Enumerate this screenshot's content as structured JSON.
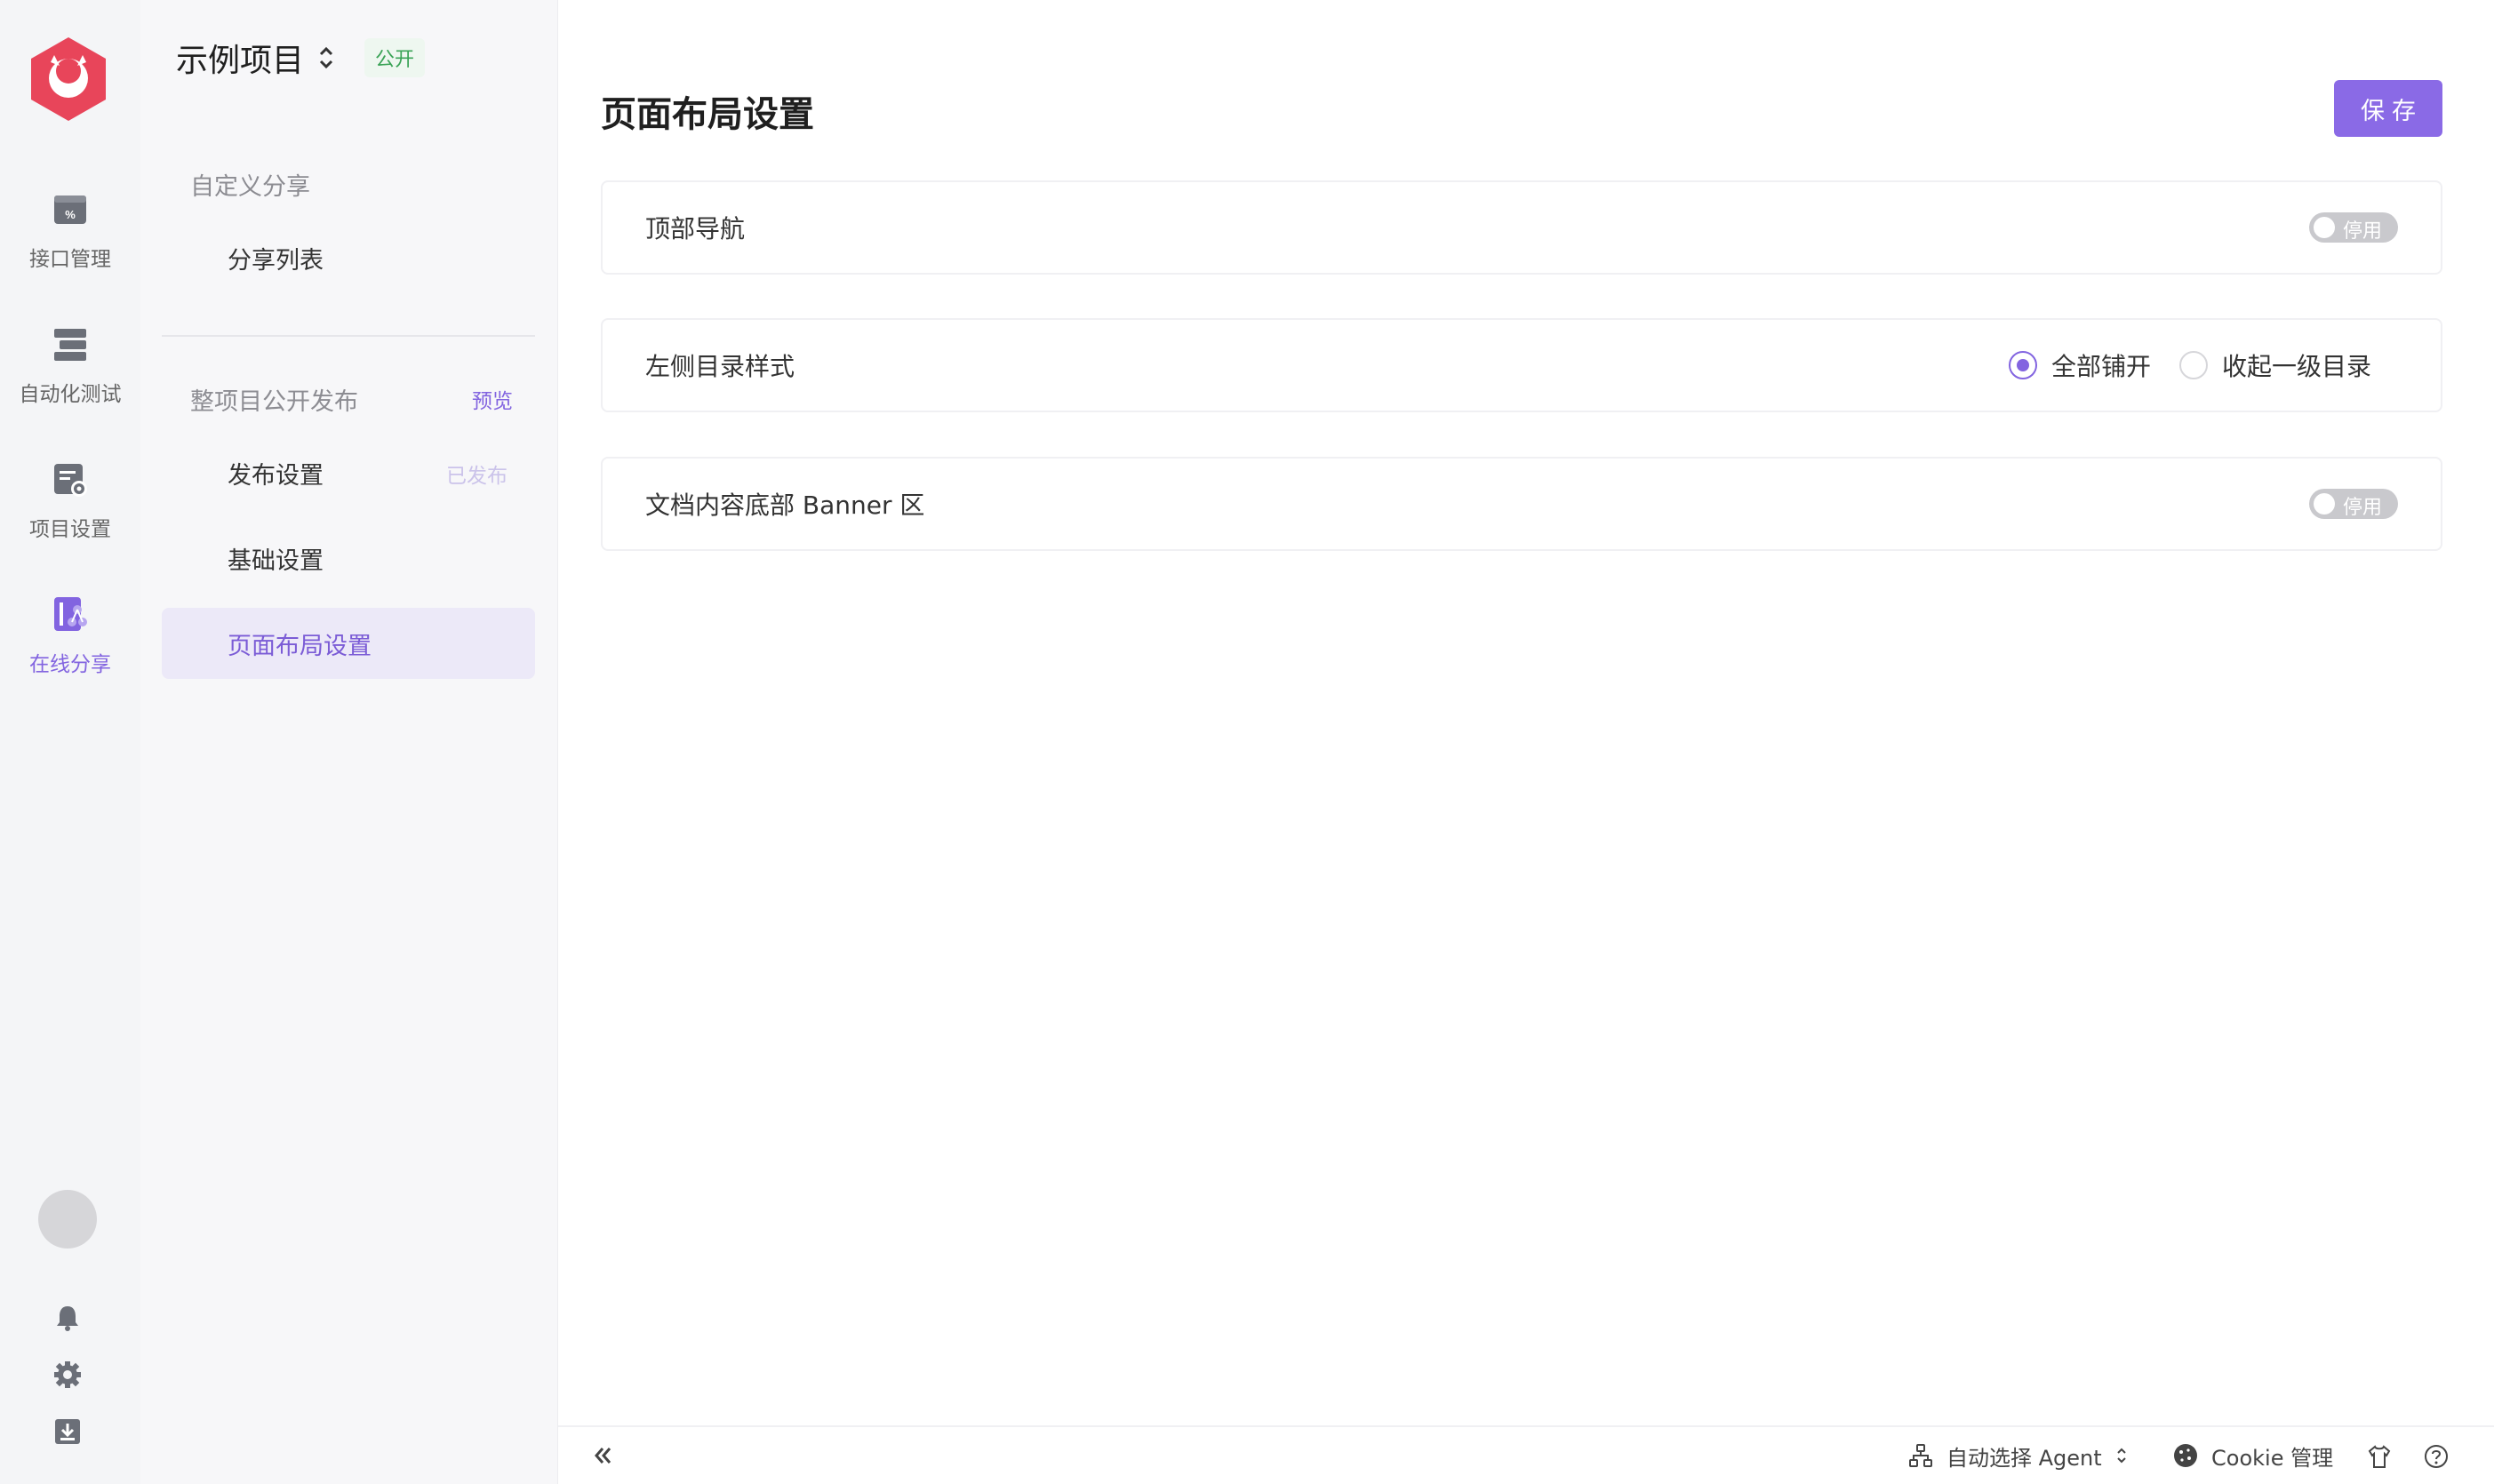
{
  "project": {
    "name": "示例项目",
    "badge": "公开"
  },
  "rail": {
    "items": [
      {
        "label": "接口管理",
        "icon": "api-icon"
      },
      {
        "label": "自动化测试",
        "icon": "automation-icon"
      },
      {
        "label": "项目设置",
        "icon": "project-settings-icon"
      },
      {
        "label": "在线分享",
        "icon": "share-icon"
      }
    ],
    "active_index": 3
  },
  "sidebar": {
    "group1": "自定义分享",
    "share_list": "分享列表",
    "group2": "整项目公开发布",
    "preview": "预览",
    "publish_settings": "发布设置",
    "published_status": "已发布",
    "basic_settings": "基础设置",
    "layout_settings": "页面布局设置"
  },
  "main": {
    "title": "页面布局设置",
    "save_label": "保存",
    "settings": [
      {
        "label": "顶部导航",
        "type": "toggle",
        "value": "停用"
      },
      {
        "label": "左侧目录样式",
        "type": "radio",
        "options": [
          "全部铺开",
          "收起一级目录"
        ],
        "selected": 0
      },
      {
        "label": "文档内容底部 Banner 区",
        "type": "toggle",
        "value": "停用"
      }
    ]
  },
  "footer": {
    "agent": "自动选择 Agent",
    "cookie": "Cookie 管理"
  },
  "colors": {
    "accent": "#8264e0",
    "public_badge": "#3aa356",
    "logo": "#e8455a"
  }
}
